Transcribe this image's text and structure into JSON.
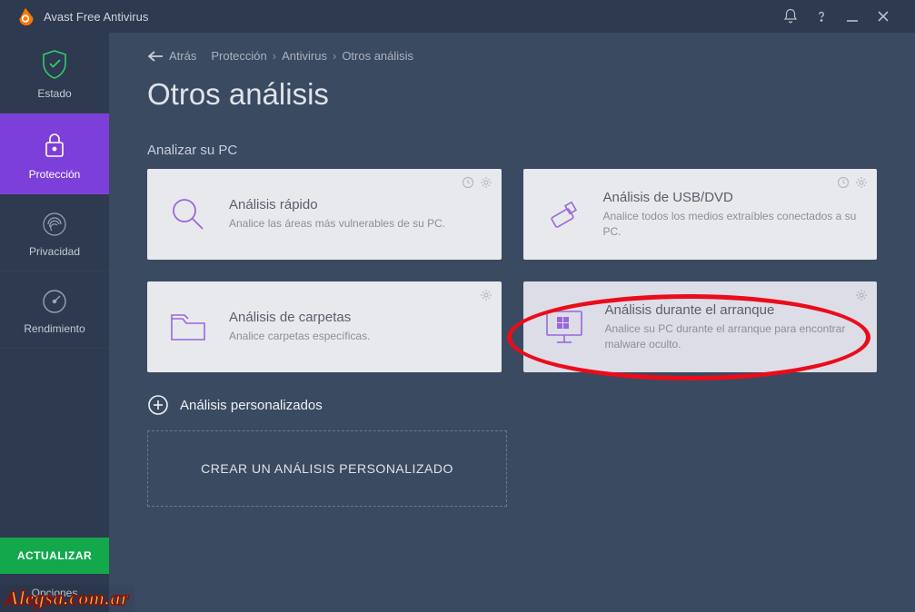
{
  "app": {
    "title": "Avast Free Antivirus"
  },
  "sidebar": {
    "items": [
      {
        "label": "Estado"
      },
      {
        "label": "Protección"
      },
      {
        "label": "Privacidad"
      },
      {
        "label": "Rendimiento"
      }
    ],
    "update": "ACTUALIZAR",
    "options": "Opciones"
  },
  "breadcrumb": {
    "back": "Atrás",
    "items": [
      "Protección",
      "Antivirus",
      "Otros análisis"
    ]
  },
  "page": {
    "title": "Otros análisis",
    "section": "Analizar su PC"
  },
  "cards": [
    {
      "title": "Análisis rápido",
      "sub": "Analice las áreas más vulnerables de su PC."
    },
    {
      "title": "Análisis de USB/DVD",
      "sub": "Analice todos los medios extraíbles conectados a su PC."
    },
    {
      "title": "Análisis de carpetas",
      "sub": "Analice carpetas específicas."
    },
    {
      "title": "Análisis durante el arranque",
      "sub": "Analice su PC durante el arranque para encontrar malware oculto."
    }
  ],
  "custom": {
    "header": "Análisis personalizados",
    "create": "CREAR UN ANÁLISIS PERSONALIZADO"
  },
  "watermark": "Alegsa.com.ar",
  "colors": {
    "accent": "#7d3fd9",
    "green": "#14a84d",
    "annotation": "#eb0c1a"
  }
}
